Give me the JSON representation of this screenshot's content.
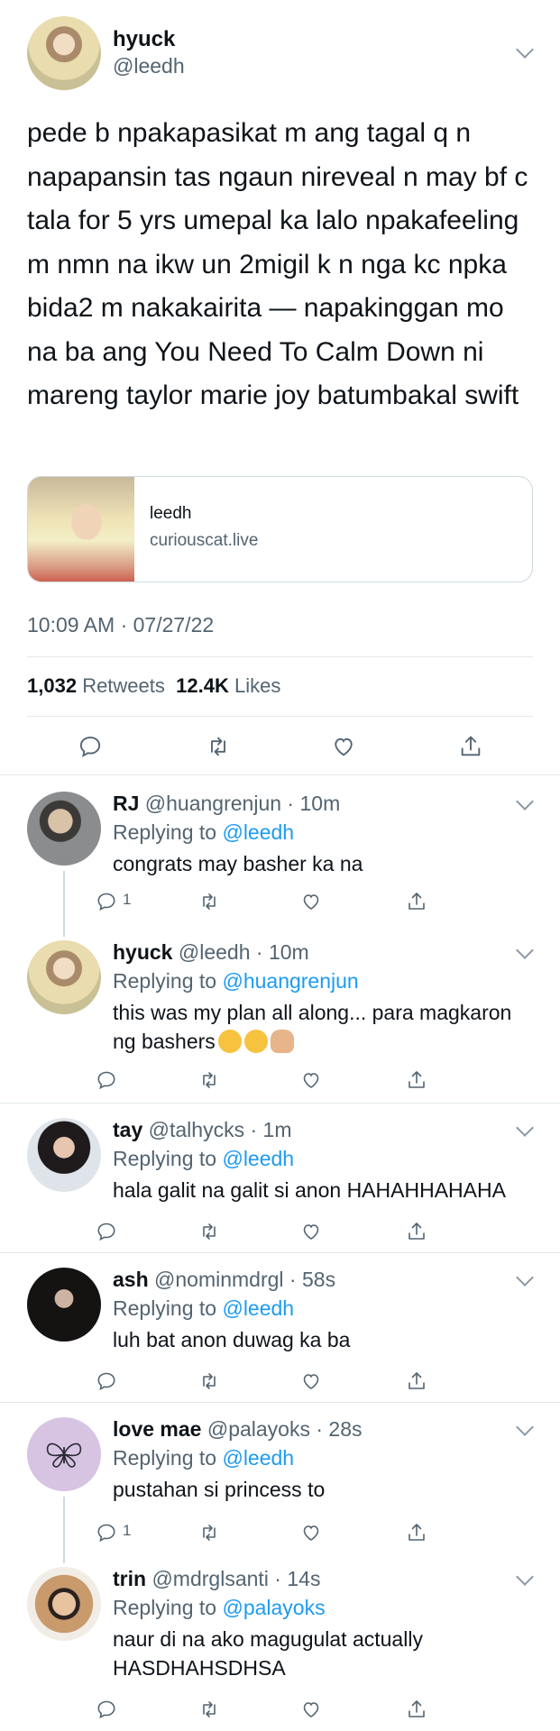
{
  "main_tweet": {
    "author_name": "hyuck",
    "author_handle": "@leedh",
    "text": "pede b npakapasikat m ang tagal q n napapansin tas ngaun nireveal n may bf c tala for 5 yrs umepal ka lalo npakafeeling m nmn na ikw un 2migil k n nga kc npka bida2 m nakakairita — napakinggan mo na ba ang You Need To Calm Down ni mareng taylor marie joy batumbakal swift",
    "link_card": {
      "title": "leedh",
      "domain": "curiouscat.live"
    },
    "timestamp": "10:09 AM · 07/27/22",
    "retweets_count": "1,032",
    "retweets_label": "Retweets",
    "likes_count": "12.4K",
    "likes_label": "Likes"
  },
  "replies": [
    {
      "name": "RJ",
      "handle": "@huangrenjun",
      "time": "10m",
      "replying_prefix": "Replying to",
      "replying_to": "@leedh",
      "text": "congrats may basher ka na",
      "reply_count": "1"
    },
    {
      "name": "hyuck",
      "handle": "@leedh",
      "time": "10m",
      "replying_prefix": "Replying to",
      "replying_to": "@huangrenjun",
      "text": "this was my plan all along... para magkaron ng bashers",
      "emojis": [
        "pensive-emoji",
        "pensive-emoji",
        "raised-hand-emoji"
      ],
      "reply_count": ""
    },
    {
      "name": "tay",
      "handle": "@talhycks",
      "time": "1m",
      "replying_prefix": "Replying to",
      "replying_to": "@leedh",
      "text": "hala galit na galit si anon HAHAHHAHAHA",
      "reply_count": ""
    },
    {
      "name": "ash",
      "handle": "@nominmdrgl",
      "time": "58s",
      "replying_prefix": "Replying to",
      "replying_to": "@leedh",
      "text": "luh bat anon duwag ka ba",
      "reply_count": ""
    },
    {
      "name": "love mae",
      "handle": "@palayoks",
      "time": "28s",
      "replying_prefix": "Replying to",
      "replying_to": "@leedh",
      "text": "pustahan si princess to",
      "reply_count": "1"
    },
    {
      "name": "trin",
      "handle": "@mdrglsanti",
      "time": "14s",
      "replying_prefix": "Replying to",
      "replying_to": "@palayoks",
      "text": "naur di na ako magugulat actually HASDHAHSDHSA",
      "reply_count": ""
    }
  ],
  "icons": [
    "reply-icon",
    "retweet-icon",
    "like-icon",
    "share-icon",
    "chevron-down-icon",
    "butterfly-icon"
  ],
  "colors": {
    "link": "#1d9bf0",
    "secondary_text": "#536471",
    "divider": "#e4e9ec"
  }
}
